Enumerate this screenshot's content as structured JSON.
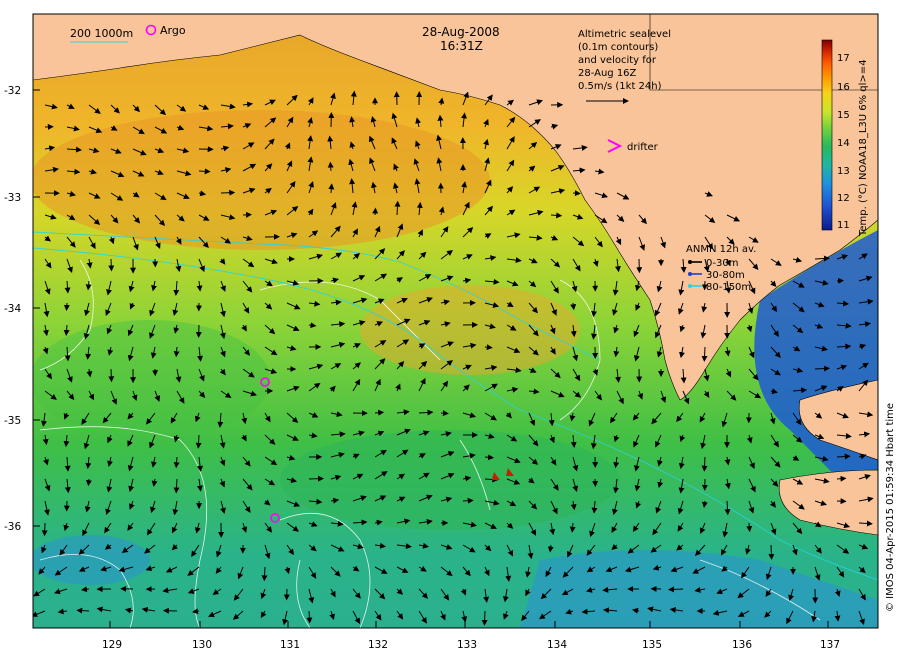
{
  "map": {
    "date": "28-Aug-2008",
    "time": "16:31Z",
    "x_ticks": [
      "129",
      "130",
      "131",
      "132",
      "133",
      "134",
      "135",
      "136",
      "137"
    ],
    "y_ticks": [
      "-32",
      "-33",
      "-34",
      "-35",
      "-36"
    ],
    "land_color": "#f9c499",
    "background_color": "#ffffff"
  },
  "scale_legend": {
    "isobaths": "200  1000m",
    "argo_label": "Argo"
  },
  "altimetry_note": {
    "lines": [
      "Altimetric sealevel",
      "(0.1m contours)",
      "and velocity for",
      "28-Aug 16Z",
      "0.5m/s (1kt 24h)"
    ]
  },
  "drifter": {
    "label": "drifter",
    "color": "#ff00ff"
  },
  "anmn_legend": {
    "title": "ANMN 12h av.",
    "items": [
      {
        "label": "0-30m",
        "color": "#000000"
      },
      {
        "label": "30-80m",
        "color": "#1f3fcf"
      },
      {
        "label": "80-150m",
        "color": "#29d3e0"
      }
    ]
  },
  "colorbar": {
    "ticks": [
      "17",
      "16",
      "15",
      "14",
      "13",
      "12",
      "11"
    ],
    "label": "Temp. (°C) NOAA18_L3U 6% ql>=4",
    "colors": [
      "#7a0000",
      "#c81e00",
      "#ff5a00",
      "#ff9b00",
      "#f7d21b",
      "#c8e62a",
      "#77d33c",
      "#29b85c",
      "#1fb6a4",
      "#1f8fde",
      "#1f4fd0",
      "#0a1c8c"
    ]
  },
  "credit": "© IMOS 04-Apr-2015 01:59:34 Hbart time"
}
